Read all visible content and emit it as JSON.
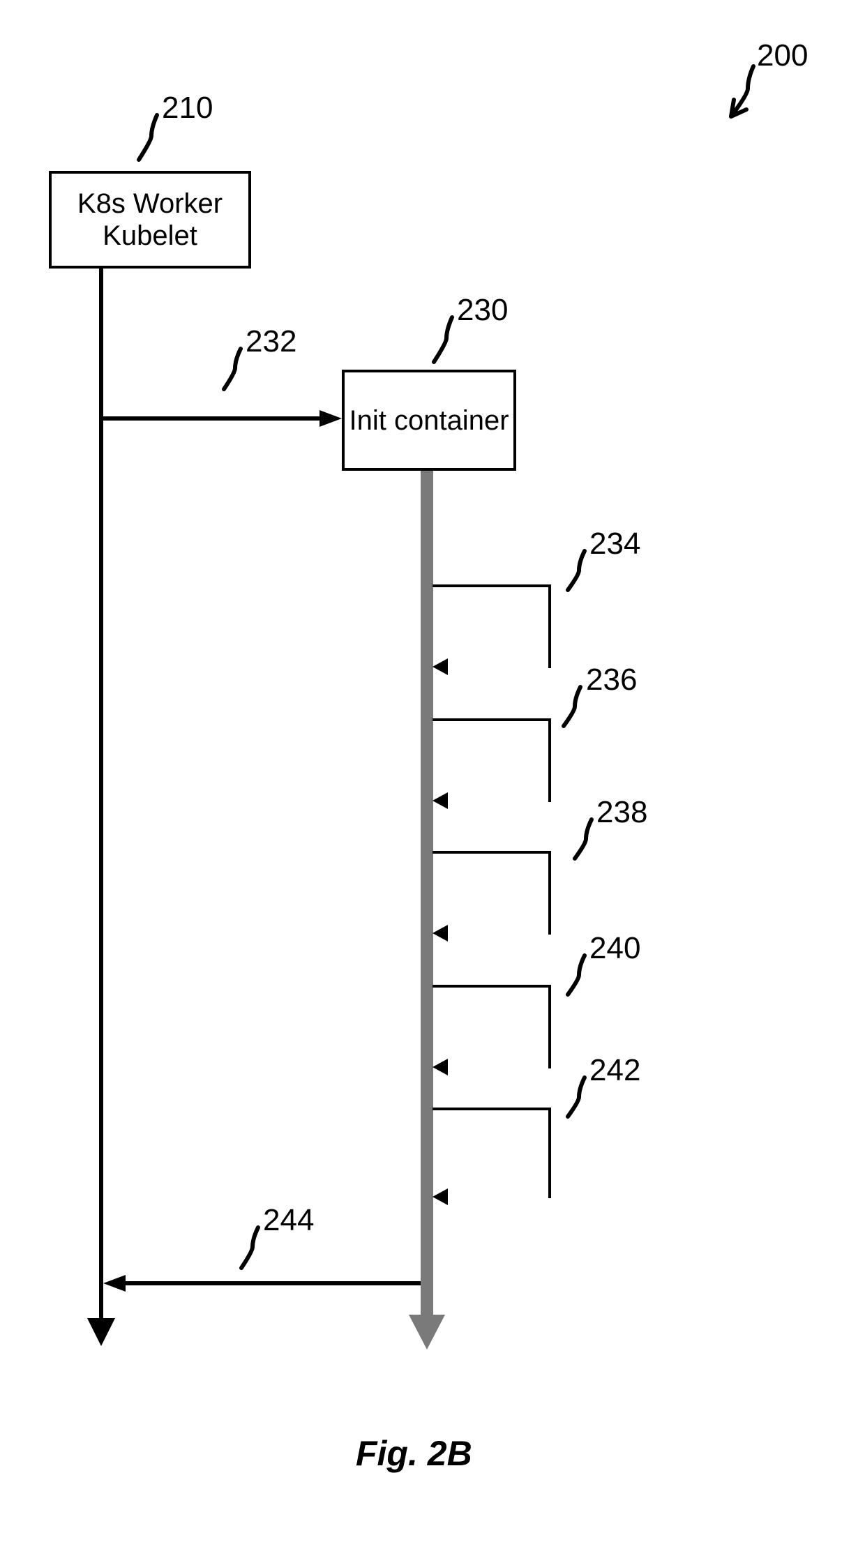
{
  "figure": {
    "caption": "Fig. 2B"
  },
  "refs": {
    "r200": "200",
    "r210": "210",
    "r230": "230",
    "r232": "232",
    "r234": "234",
    "r236": "236",
    "r238": "238",
    "r240": "240",
    "r242": "242",
    "r244": "244"
  },
  "blocks": {
    "k8s": "K8s Worker Kubelet",
    "init": "Init container"
  }
}
